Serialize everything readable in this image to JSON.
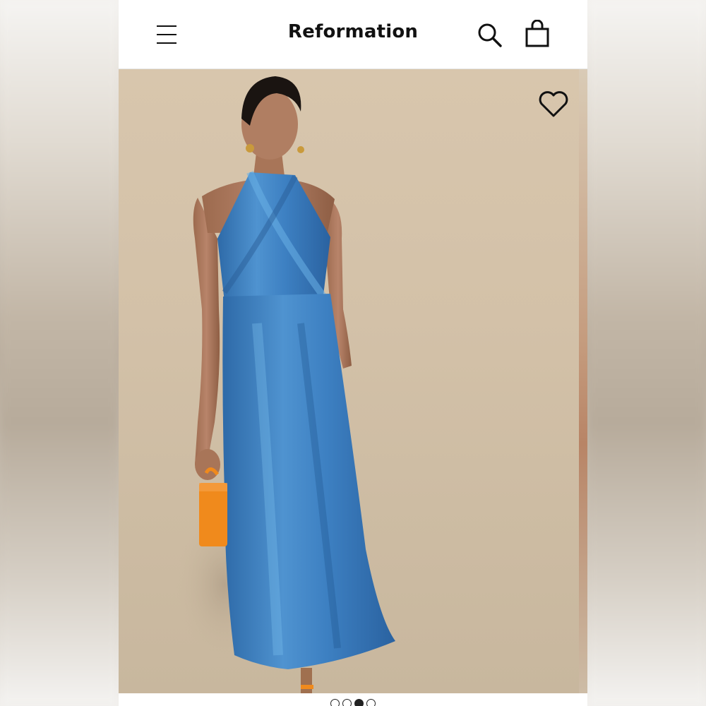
{
  "header": {
    "brand": "Reformation",
    "icons": [
      "menu-icon",
      "search-icon",
      "shopping-bag-icon"
    ]
  },
  "product_image": {
    "favorite_icon": "heart-icon",
    "dress_color": "#3b7fc0",
    "bag_color": "#f08a1c"
  },
  "carousel": {
    "total": 4,
    "active_index": 2
  }
}
